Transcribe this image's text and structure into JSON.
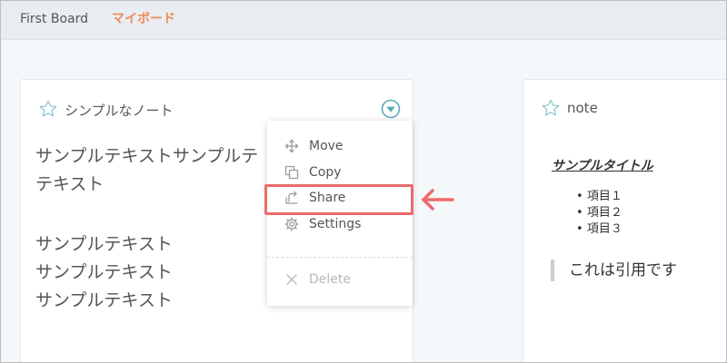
{
  "tabs": [
    {
      "label": "First Board"
    },
    {
      "label": "マイボード",
      "active": true
    }
  ],
  "colors": {
    "accent": "#f08a5d",
    "icon_teal": "#5aa9b7",
    "highlight": "#ec6b6b"
  },
  "card1": {
    "title": "シンプルなノート",
    "star_icon": "star-outline-icon",
    "toggle_icon": "chevron-down-circle-icon",
    "lines": [
      "サンプルテキストサンプルテ",
      "テキスト",
      "サンプルテキスト",
      "サンプルテキスト",
      "サンプルテキスト"
    ]
  },
  "card2": {
    "title": "note",
    "star_icon": "star-outline-icon",
    "heading": "サンプルタイトル",
    "list": [
      "項目１",
      "項目２",
      "項目３"
    ],
    "quote": "これは引用です"
  },
  "menu": {
    "move": {
      "label": "Move",
      "icon": "move-arrows-icon"
    },
    "copy": {
      "label": "Copy",
      "icon": "copy-icon"
    },
    "share": {
      "label": "Share",
      "icon": "share-icon"
    },
    "settings": {
      "label": "Settings",
      "icon": "gear-icon"
    },
    "delete": {
      "label": "Delete",
      "icon": "close-icon"
    }
  }
}
